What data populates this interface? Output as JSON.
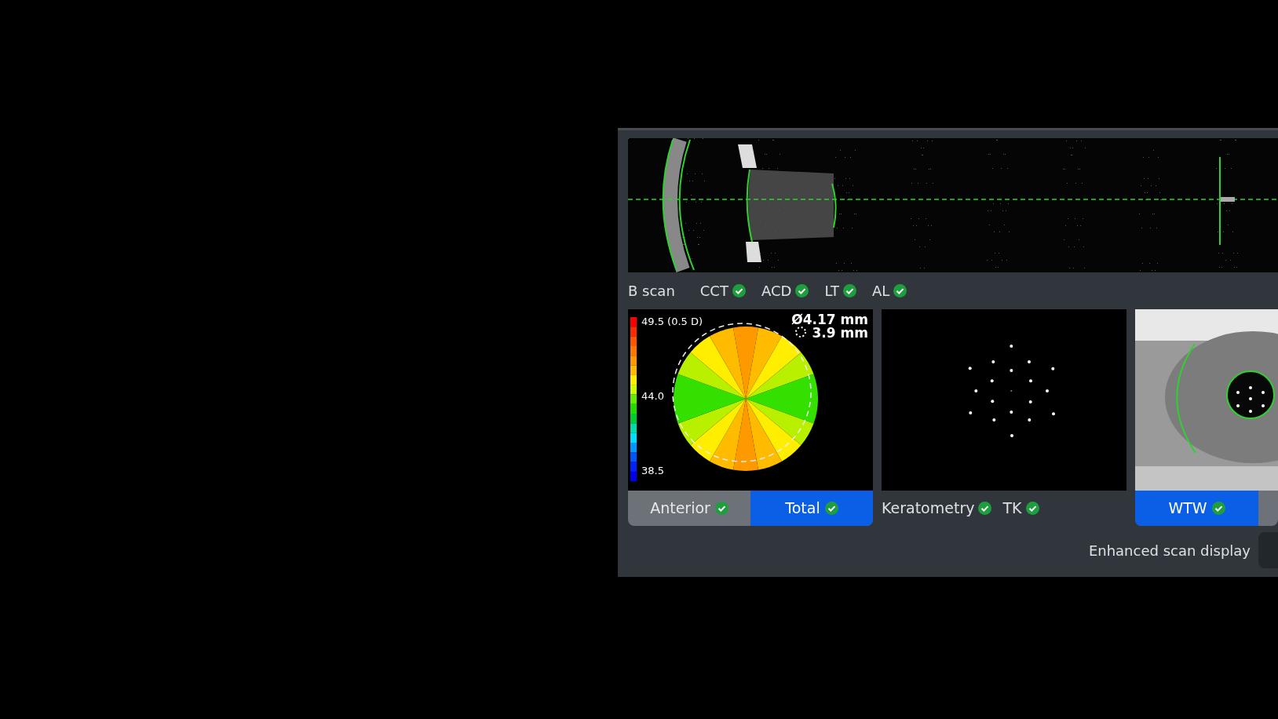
{
  "b_scan": {
    "label": "B scan",
    "measurements": [
      {
        "label": "CCT",
        "checked": true
      },
      {
        "label": "ACD",
        "checked": true
      },
      {
        "label": "LT",
        "checked": true
      },
      {
        "label": "AL",
        "checked": true
      }
    ]
  },
  "topography": {
    "scale_labels": [
      "49.5 (0.5 D)",
      "44.0",
      "38.5"
    ],
    "diameter": "Ø4.17 mm",
    "zone": "3.9 mm",
    "tabs": [
      {
        "label": "Anterior",
        "checked": true,
        "selected": false
      },
      {
        "label": "Total",
        "checked": true,
        "selected": true
      }
    ]
  },
  "keratometry": {
    "measurements": [
      {
        "label": "Keratometry",
        "checked": true
      },
      {
        "label": "TK",
        "checked": true
      }
    ]
  },
  "white_to_white": {
    "tabs": [
      {
        "label": "WTW",
        "checked": true,
        "selected": true
      }
    ]
  },
  "enhanced_scan_display": {
    "label": "Enhanced scan display",
    "on": false
  }
}
